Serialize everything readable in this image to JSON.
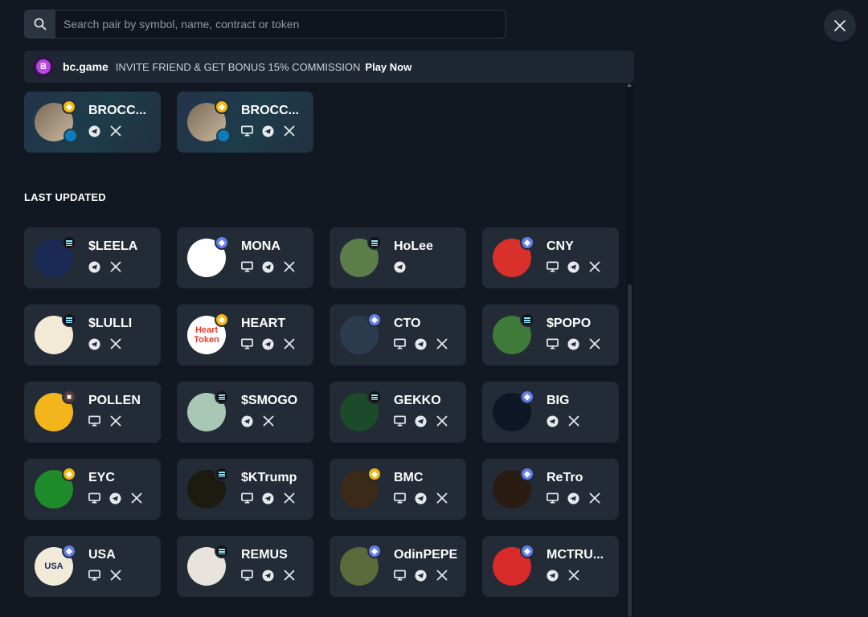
{
  "search": {
    "placeholder": "Search pair by symbol, name, contract or token"
  },
  "promo": {
    "brand": "bc.game",
    "message": "INVITE FRIEND & GET BONUS 15% COMMISSION",
    "cta": "Play Now",
    "logo_text": "B"
  },
  "featured": [
    {
      "name": "BROCC...",
      "chain": "bsc",
      "links": [
        "telegram",
        "x"
      ]
    },
    {
      "name": "BROCC...",
      "chain": "bsc",
      "links": [
        "website",
        "telegram",
        "x"
      ]
    }
  ],
  "section_title": "LAST UPDATED",
  "tokens": [
    {
      "name": "$LEELA",
      "chain": "sol",
      "links": [
        "telegram",
        "x"
      ],
      "avatar_bg": "#1a2a55",
      "avatar_fg": "#fff",
      "avatar_text": ""
    },
    {
      "name": "MONA",
      "chain": "eth",
      "links": [
        "website",
        "telegram",
        "x"
      ],
      "avatar_bg": "#ffffff",
      "avatar_fg": "#333",
      "avatar_text": ""
    },
    {
      "name": "HoLee",
      "chain": "sol",
      "links": [
        "telegram"
      ],
      "avatar_bg": "#5b7d4a",
      "avatar_fg": "#fff",
      "avatar_text": ""
    },
    {
      "name": "CNY",
      "chain": "eth",
      "links": [
        "website",
        "telegram",
        "x"
      ],
      "avatar_bg": "#d9302b",
      "avatar_fg": "#fff",
      "avatar_text": ""
    },
    {
      "name": "$LULLI",
      "chain": "sol",
      "links": [
        "telegram",
        "x"
      ],
      "avatar_bg": "#f3ead6",
      "avatar_fg": "#a33",
      "avatar_text": ""
    },
    {
      "name": "HEART",
      "chain": "bsc",
      "links": [
        "website",
        "telegram",
        "x"
      ],
      "avatar_bg": "#ffffff",
      "avatar_fg": "#e23b30",
      "avatar_text": "Heart Token"
    },
    {
      "name": "CTO",
      "chain": "eth",
      "links": [
        "website",
        "telegram",
        "x"
      ],
      "avatar_bg": "#2c3c4e",
      "avatar_fg": "#fff",
      "avatar_text": ""
    },
    {
      "name": "$POPO",
      "chain": "sol",
      "links": [
        "website",
        "telegram",
        "x"
      ],
      "avatar_bg": "#3e7a3a",
      "avatar_fg": "#fff",
      "avatar_text": ""
    },
    {
      "name": "POLLEN",
      "chain": "base",
      "links": [
        "website",
        "x"
      ],
      "avatar_bg": "#f3b51c",
      "avatar_fg": "#3a2a00",
      "avatar_text": ""
    },
    {
      "name": "$SMOGO",
      "chain": "sol",
      "links": [
        "telegram",
        "x"
      ],
      "avatar_bg": "#a9c7b5",
      "avatar_fg": "#fff",
      "avatar_text": ""
    },
    {
      "name": "GEKKO",
      "chain": "sol",
      "links": [
        "website",
        "telegram",
        "x"
      ],
      "avatar_bg": "#1c4a2a",
      "avatar_fg": "#4bd14b",
      "avatar_text": ""
    },
    {
      "name": "BIG",
      "chain": "eth",
      "links": [
        "telegram",
        "x"
      ],
      "avatar_bg": "#0d1726",
      "avatar_fg": "#f0a81a",
      "avatar_text": ""
    },
    {
      "name": "EYC",
      "chain": "bsc",
      "links": [
        "website",
        "telegram",
        "x"
      ],
      "avatar_bg": "#1e8a2a",
      "avatar_fg": "#fff",
      "avatar_text": ""
    },
    {
      "name": "$KTrump",
      "chain": "sol",
      "links": [
        "website",
        "telegram",
        "x"
      ],
      "avatar_bg": "#1d1a10",
      "avatar_fg": "#d7b543",
      "avatar_text": ""
    },
    {
      "name": "BMC",
      "chain": "bsc",
      "links": [
        "website",
        "telegram",
        "x"
      ],
      "avatar_bg": "#3b2a1a",
      "avatar_fg": "#c79a5b",
      "avatar_text": ""
    },
    {
      "name": "ReTro",
      "chain": "eth",
      "links": [
        "website",
        "telegram",
        "x"
      ],
      "avatar_bg": "#2a1c12",
      "avatar_fg": "#c7813a",
      "avatar_text": ""
    },
    {
      "name": "USA",
      "chain": "eth",
      "links": [
        "website",
        "x"
      ],
      "avatar_bg": "#f2ead9",
      "avatar_fg": "#1a2a5a",
      "avatar_text": "USA"
    },
    {
      "name": "REMUS",
      "chain": "sol",
      "links": [
        "website",
        "telegram",
        "x"
      ],
      "avatar_bg": "#e8e3dc",
      "avatar_fg": "#888",
      "avatar_text": ""
    },
    {
      "name": "OdinPEPE",
      "chain": "eth",
      "links": [
        "website",
        "telegram",
        "x"
      ],
      "avatar_bg": "#5a6a3a",
      "avatar_fg": "#fff",
      "avatar_text": ""
    },
    {
      "name": "MCTRU...",
      "chain": "eth",
      "links": [
        "telegram",
        "x"
      ],
      "avatar_bg": "#d92a2a",
      "avatar_fg": "#f5d21f",
      "avatar_text": ""
    }
  ]
}
